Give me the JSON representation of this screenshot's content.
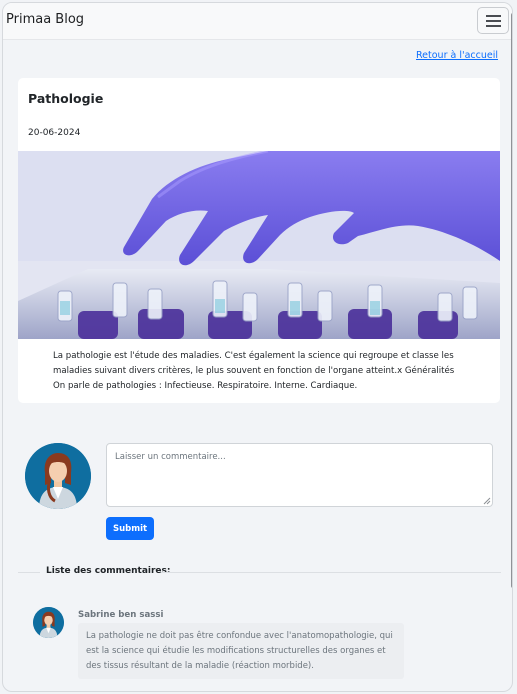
{
  "navbar": {
    "brand": "Primaa Blog",
    "toggler_icon": "hamburger-menu-icon"
  },
  "back_link": "Retour à l'accueil",
  "post": {
    "title": "Pathologie",
    "date": "20-06-2024",
    "image_subject": "gloved hand picking test tubes",
    "body": "La pathologie est l'étude des maladies. C'est également la science qui regroupe et classe les maladies suivant divers critères, le plus souvent en fonction de l'organe atteint.x Généralités On parle de pathologies : Infectieuse. Respiratoire. Interne. Cardiaque."
  },
  "comment_form": {
    "placeholder": "Laisser un commentaire...",
    "submit_label": "Submit",
    "avatar_icon": "user-avatar-icon"
  },
  "comments": {
    "title": "Liste des commentaires:",
    "items": [
      {
        "author": "Sabrine ben sassi",
        "text": "La pathologie ne doit pas être confondue avec l'anatomopathologie, qui est la science qui étudie les modifications structurelles des organes et des tissus résultant de la maladie (réaction morbide)."
      }
    ]
  },
  "colors": {
    "accent": "#0d6efd",
    "avatar_bg": "#0f6ea0",
    "page_bg": "#f2f4f7"
  }
}
